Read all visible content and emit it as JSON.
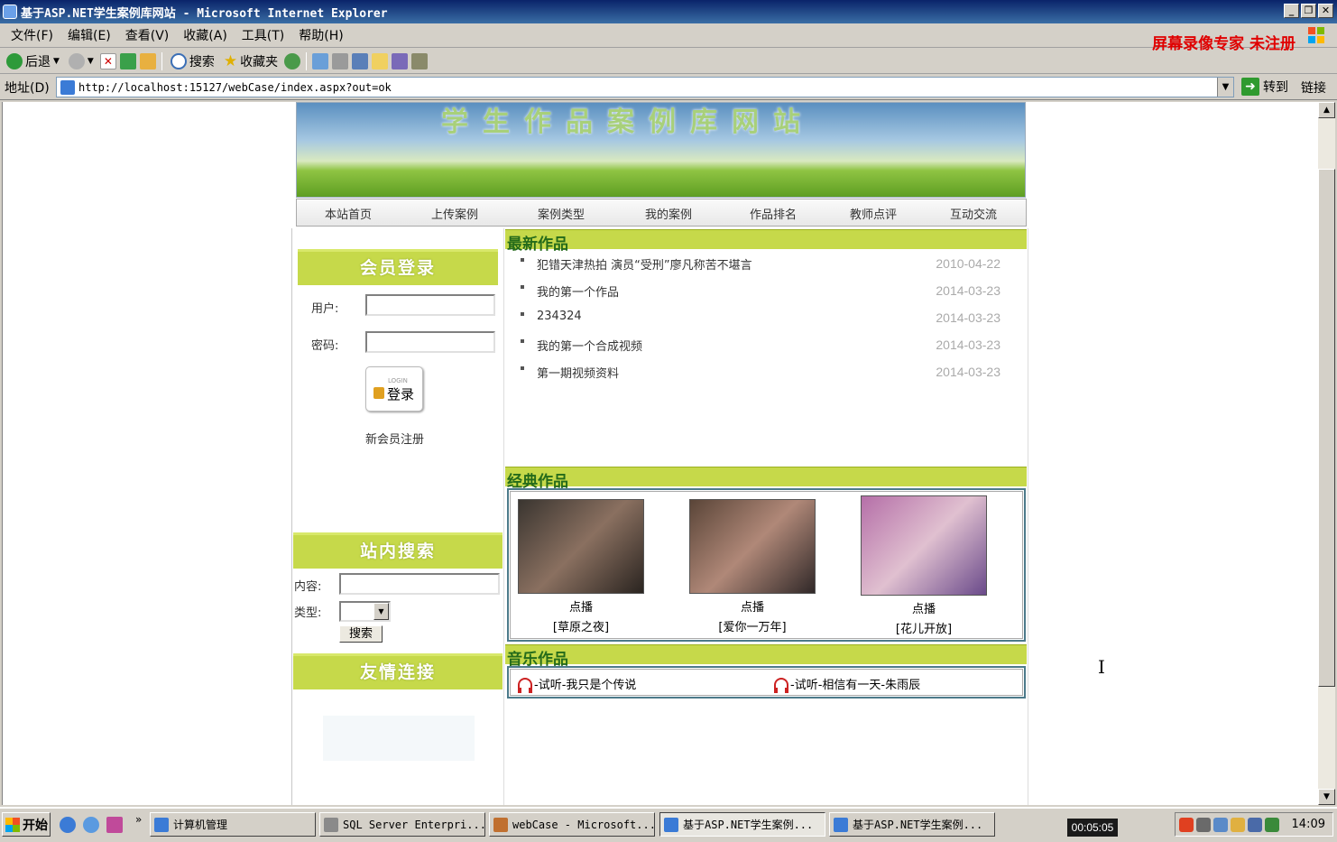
{
  "window": {
    "title": "基于ASP.NET学生案例库网站 - Microsoft Internet Explorer",
    "buttons": [
      "_",
      "❐",
      "✕"
    ]
  },
  "menubar": {
    "items": [
      "文件(F)",
      "编辑(E)",
      "查看(V)",
      "收藏(A)",
      "工具(T)",
      "帮助(H)"
    ],
    "watermark": "屏幕录像专家 未注册"
  },
  "toolbar": {
    "back": "后退",
    "search": "搜索",
    "favorites": "收藏夹"
  },
  "address": {
    "label": "地址(D)",
    "url": "http://localhost:15127/webCase/index.aspx?out=ok",
    "go": "转到",
    "links": "链接"
  },
  "site": {
    "banner_title": "学生作品案例库网站",
    "nav": [
      "本站首页",
      "上传案例",
      "案例类型",
      "我的案例",
      "作品排名",
      "教师点评",
      "互动交流"
    ],
    "login": {
      "heading": "会员登录",
      "user_label": "用户:",
      "password_label": "密码:",
      "button_small": "LOGIN",
      "button_label": "登录",
      "register": "新会员注册"
    },
    "search": {
      "heading": "站内搜索",
      "content_label": "内容:",
      "type_label": "类型:",
      "button": "搜索"
    },
    "links_heading": "友情连接",
    "latest": {
      "heading": "最新作品",
      "items": [
        {
          "title": "犯错天津热拍 演员“受刑”廖凡称苦不堪言",
          "date": "2010-04-22"
        },
        {
          "title": "我的第一个作品",
          "date": "2014-03-23"
        },
        {
          "title": "234324",
          "date": "2014-03-23"
        },
        {
          "title": "我的第一个合成视频",
          "date": "2014-03-23"
        },
        {
          "title": "第一期视频资料",
          "date": "2014-03-23"
        }
      ]
    },
    "classic": {
      "heading": "经典作品",
      "items": [
        {
          "play": "点播",
          "name": "[草原之夜]",
          "color": "#3a3530"
        },
        {
          "play": "点播",
          "name": "[爱你一万年]",
          "color": "#5a4538"
        },
        {
          "play": "点播",
          "name": "[花儿开放]",
          "color": "#b56fa8"
        }
      ]
    },
    "music": {
      "heading": "音乐作品",
      "items": [
        "-试听-我只是个传说",
        "-试听-相信有一天-朱雨辰"
      ]
    }
  },
  "taskbar": {
    "start": "开始",
    "tasks": [
      {
        "label": "计算机管理",
        "active": false
      },
      {
        "label": "SQL Server Enterpri...",
        "active": false
      },
      {
        "label": "webCase - Microsoft...",
        "active": false
      },
      {
        "label": "基于ASP.NET学生案例...",
        "active": true
      },
      {
        "label": "基于ASP.NET学生案例...",
        "active": false
      }
    ],
    "recorder_time": "00:05:05",
    "clock": "14:09"
  }
}
